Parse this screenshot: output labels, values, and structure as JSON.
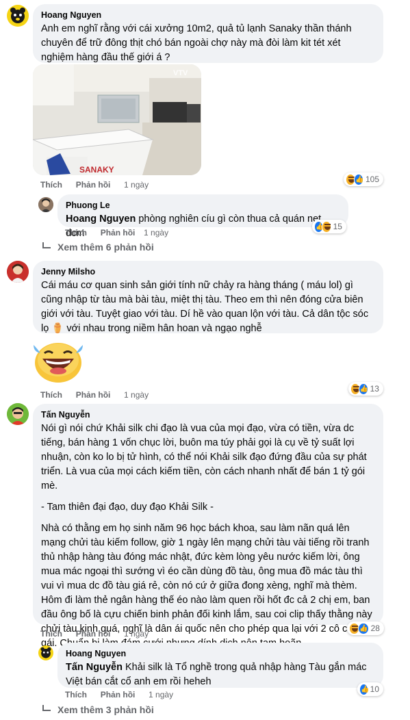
{
  "comments": [
    {
      "author": "Hoang Nguyen",
      "text": "Anh em nghĩ rằng với cái xưởng 10m2, quả tủ lạnh Sanaky thần thánh chuyên để trữ đông thịt chó bán ngoài chợ này mà đòi làm kit tét xét nghiệm hàng đầu thế giới á ?",
      "image_watermark": "VTV",
      "image_brand": "SANAKY",
      "like": "Thích",
      "reply": "Phản hồi",
      "time": "1 ngày",
      "reactions": {
        "icons": [
          "haha-icon",
          "like-icon"
        ],
        "count": "105"
      },
      "replies": [
        {
          "author": "Phuong Le",
          "mention": "Hoang Nguyen",
          "text": " phòng nghiên cíu gì còn thua cả quán net dcm",
          "like": "Thích",
          "reply": "Phản hồi",
          "time": "1 ngày",
          "reactions": {
            "icons": [
              "like-icon",
              "haha-icon"
            ],
            "count": "15"
          }
        }
      ],
      "more_replies": "Xem thêm 6 phản hồi"
    },
    {
      "author": "Jenny Milsho",
      "text": "Cái máu cơ quan sinh sản giới tính nữ chảy ra hàng tháng ( máu lol) gì cũng nhập từ tàu mà bài tàu, miệt thị tàu. Theo em thì nên đóng cửa biên giới với tàu. Tuyệt giao với tàu. Dí hề vào quan lộn với tàu. Cả dân tộc sóc lọ",
      "text_emoji": "⚱️",
      "text_tail": " với nhau trong niềm hân hoan và ngạo nghễ",
      "sticker": "laughing-emoji",
      "like": "Thích",
      "reply": "Phản hồi",
      "time": "1 ngày",
      "reactions": {
        "icons": [
          "haha-icon",
          "like-icon"
        ],
        "count": "13"
      }
    },
    {
      "author": "Tấn Nguyễn",
      "paragraphs": [
        "Nói gì nói chứ Khải silk chi đạo là vua của mọi đạo, vừa có tiền, vừa dc tiếng, bán hàng 1 vốn chục lời, buôn ma túy phải gọi là cụ về tỷ suất lợi nhuận, còn ko lo bị tử hình, có thể nói Khải silk đạo đứng đầu của sự phát triển. Là vua của mọi cách kiếm tiền, còn cách nhanh nhất để bán 1 tỷ gói mè.",
        "- Tam thiên đại đạo, duy đạo Khải Silk -",
        "Nhà có thằng em họ sinh năm 96 học bách khoa, sau làm nãn quá lên mạng chửi tàu kiếm follow, giờ 1 ngày lên mạng chửi tàu vài tiếng rồi tranh thủ nhập hàng tàu đóng mác nhật, đức kèm lòng yêu nước kiếm lời, ông mua mác ngoại thì sướng vì éo cần dùng đồ tàu, ông mua đồ mác tàu thì vui vì mua dc đồ tàu giá rẻ, còn nó cứ ở giữa đong xèng, nghĩ mà thèm. Hôm đi làm thẻ ngân hàng thế éo nào làm quen rồi hốt đc cả 2 chị em, ban đầu ông bố là cựu chiến binh phản đối kinh lắm, sau coi clip thấy thằng này chửi tàu kinh quá, nghĩ là dân ái quốc nên cho phép qua lại với 2 cô con gái. Chuẩn bị làm đám cưới nhưng dính dịch nên tạm hoãn"
      ],
      "like": "Thích",
      "reply": "Phản hồi",
      "time": "1 ngày",
      "reactions": {
        "icons": [
          "haha-icon",
          "like-icon"
        ],
        "count": "28"
      },
      "replies": [
        {
          "author": "Hoang Nguyen",
          "mention": "Tấn Nguyễn",
          "text": " Khải silk là Tổ nghề trong quả nhập hàng Tàu gắn mác Việt bán cắt cổ anh em rồi heheh",
          "like": "Thích",
          "reply": "Phản hồi",
          "time": "1 ngày",
          "reactions": {
            "icons": [
              "like-icon"
            ],
            "count": "10"
          }
        }
      ],
      "more_replies": "Xem thêm 3 phản hồi"
    }
  ],
  "colors": {
    "bubble": "#f0f2f5",
    "meta": "#65676b",
    "like_blue": "#1877f2",
    "haha_yellow": "#f7b125"
  }
}
